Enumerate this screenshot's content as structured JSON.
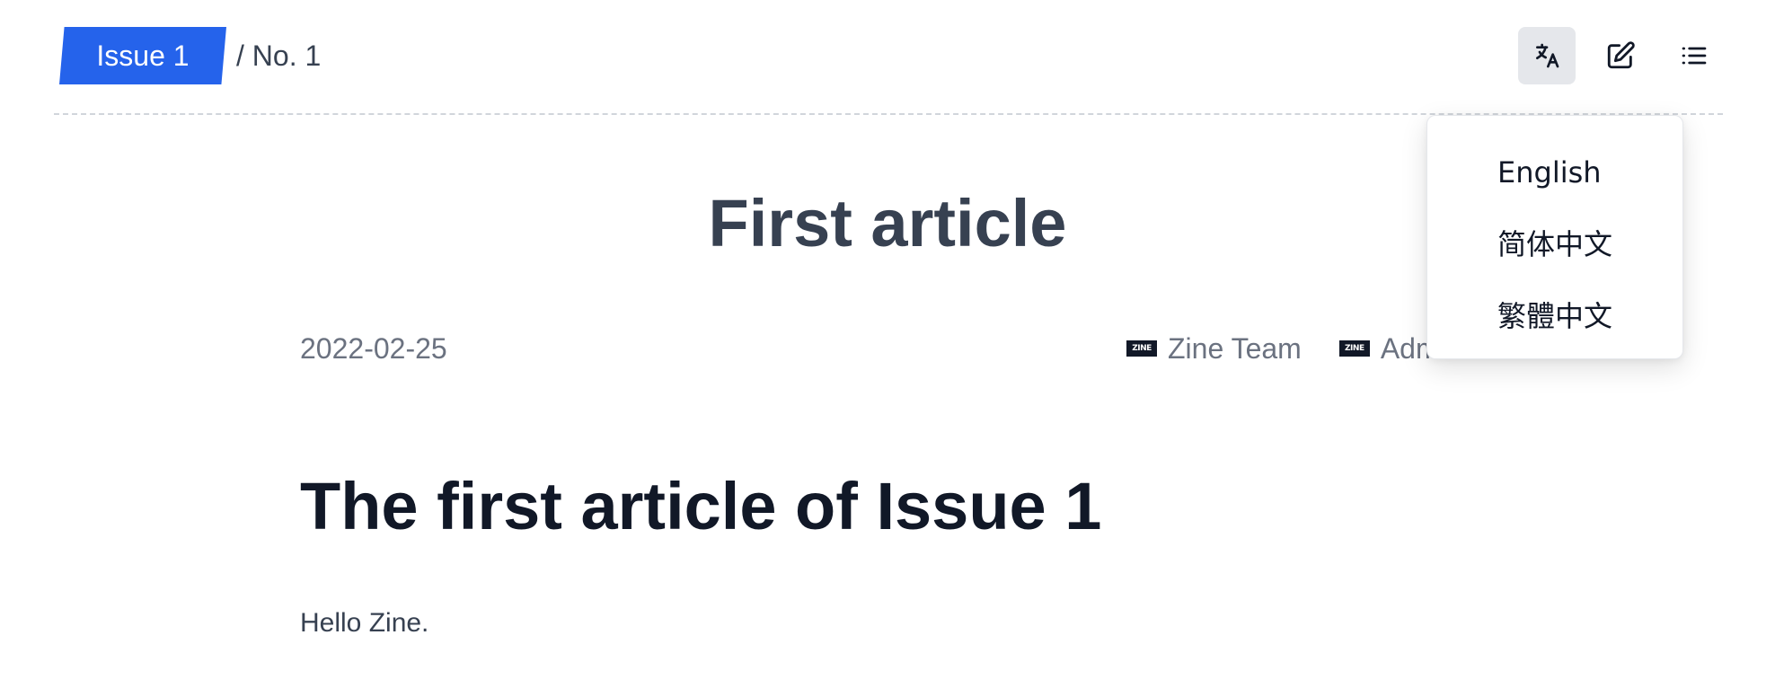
{
  "header": {
    "issue_label": "Issue 1",
    "breadcrumb_rest": "/ No. 1",
    "toolbar": {
      "language_icon": "translate-icon",
      "edit_icon": "edit-icon",
      "toc_icon": "list-icon"
    }
  },
  "language_menu": {
    "items": [
      {
        "label": "English"
      },
      {
        "label": "简体中文"
      },
      {
        "label": "繁體中文"
      }
    ]
  },
  "article": {
    "title": "First article",
    "date": "2022-02-25",
    "authors": [
      {
        "logo": "ZINE",
        "name": "Zine Team"
      },
      {
        "logo": "ZINE",
        "name": "Admin"
      }
    ],
    "heading": "The first article of Issue 1",
    "body": "Hello Zine."
  },
  "colors": {
    "accent": "#2563eb",
    "title": "#374151",
    "heading": "#111827",
    "muted": "#6b7280",
    "active_button_bg": "#e5e7eb"
  }
}
